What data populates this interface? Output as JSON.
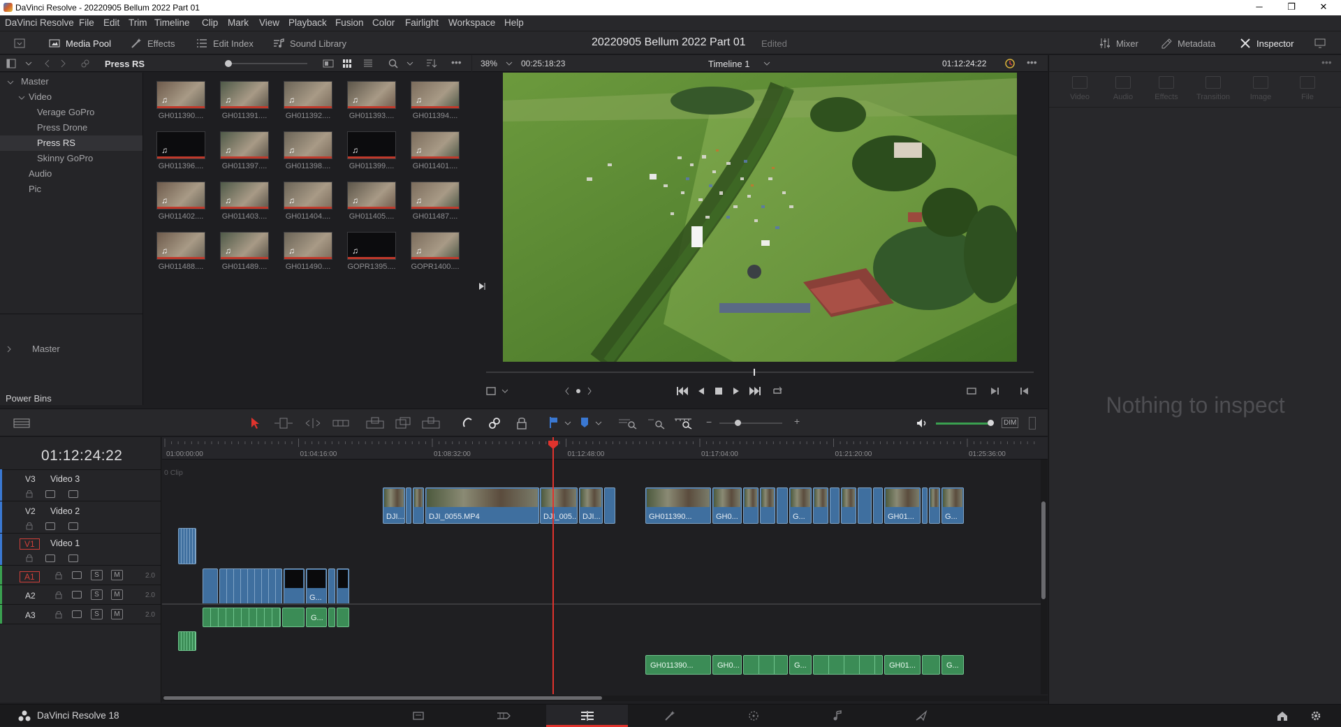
{
  "window": {
    "title": "DaVinci Resolve - 20220905 Bellum 2022 Part 01",
    "minimize": "─",
    "maximize": "❐",
    "close": "✕"
  },
  "menu": [
    "DaVinci Resolve",
    "File",
    "Edit",
    "Trim",
    "Timeline",
    "Clip",
    "Mark",
    "View",
    "Playback",
    "Fusion",
    "Color",
    "Fairlight",
    "Workspace",
    "Help"
  ],
  "toolbar": {
    "media_pool": "Media Pool",
    "effects": "Effects",
    "edit_index": "Edit Index",
    "sound_library": "Sound Library",
    "project_title": "20220905 Bellum 2022 Part 01",
    "project_status": "Edited",
    "mixer": "Mixer",
    "metadata": "Metadata",
    "inspector": "Inspector"
  },
  "media_pool": {
    "current_bin": "Press RS",
    "bins": [
      {
        "label": "Master",
        "level": 0,
        "expanded": true
      },
      {
        "label": "Video",
        "level": 1,
        "expanded": true
      },
      {
        "label": "Verage GoPro",
        "level": 2
      },
      {
        "label": "Press Drone",
        "level": 2
      },
      {
        "label": "Press RS",
        "level": 2,
        "selected": true
      },
      {
        "label": "Skinny GoPro",
        "level": 2
      },
      {
        "label": "Audio",
        "level": 1
      },
      {
        "label": "Pic",
        "level": 1
      }
    ],
    "power_bins_title": "Power Bins",
    "power_bins": [
      {
        "label": "Master"
      }
    ],
    "clips": [
      {
        "name": "GH011390....",
        "dark": false
      },
      {
        "name": "GH011391....",
        "dark": false
      },
      {
        "name": "GH011392....",
        "dark": false
      },
      {
        "name": "GH011393....",
        "dark": false
      },
      {
        "name": "GH011394....",
        "dark": false
      },
      {
        "name": "GH011396....",
        "dark": true
      },
      {
        "name": "GH011397....",
        "dark": false
      },
      {
        "name": "GH011398....",
        "dark": false
      },
      {
        "name": "GH011399....",
        "dark": true
      },
      {
        "name": "GH011401....",
        "dark": false
      },
      {
        "name": "GH011402....",
        "dark": false
      },
      {
        "name": "GH011403....",
        "dark": false
      },
      {
        "name": "GH011404....",
        "dark": false
      },
      {
        "name": "GH011405....",
        "dark": false
      },
      {
        "name": "GH011487....",
        "dark": false
      },
      {
        "name": "GH011488....",
        "dark": false
      },
      {
        "name": "GH011489....",
        "dark": false
      },
      {
        "name": "GH011490....",
        "dark": false
      },
      {
        "name": "GOPR1395....",
        "dark": true
      },
      {
        "name": "GOPR1400....",
        "dark": false
      }
    ]
  },
  "viewer": {
    "zoom": "38%",
    "duration": "00:25:18:23",
    "timeline_name": "Timeline 1",
    "timecode": "01:12:24:22"
  },
  "inspector": {
    "tabs": [
      "Video",
      "Audio",
      "Effects",
      "Transition",
      "Image",
      "File"
    ],
    "empty_message": "Nothing to inspect"
  },
  "timeline": {
    "timecode": "01:12:24:22",
    "ruler": [
      "01:00:00:00",
      "01:04:16:00",
      "01:08:32:00",
      "01:12:48:00",
      "01:17:04:00",
      "01:21:20:00",
      "01:25:36:00"
    ],
    "empty_track_label": "0 Clip",
    "tracks": [
      {
        "id": "V3",
        "name": "Video 3",
        "kind": "video"
      },
      {
        "id": "V2",
        "name": "Video 2",
        "kind": "video"
      },
      {
        "id": "V1",
        "name": "Video 1",
        "kind": "video"
      },
      {
        "id": "A1",
        "name": "",
        "kind": "audio",
        "level": "2.0"
      },
      {
        "id": "A2",
        "name": "",
        "kind": "audio",
        "level": "2.0"
      },
      {
        "id": "A3",
        "name": "",
        "kind": "audio",
        "level": "2.0"
      }
    ],
    "solo_label": "S",
    "mute_label": "M",
    "dim_label": "DIM",
    "clip_labels": {
      "v3_a": "DJI...",
      "v3_main": "DJI_0055.MP4",
      "v3_b": "DJI_005...",
      "v3_c": "DJI...",
      "v3_d": "GH011390...",
      "v3_e": "GH0...",
      "v3_f": "G...",
      "v3_g": "GH01...",
      "v3_h": "G...",
      "v1_a": "G...",
      "a1_a": "G...",
      "a3_a": "GH011390...",
      "a3_b": "GH0...",
      "a3_c": "G...",
      "a3_d": "GH01...",
      "a3_e": "G..."
    }
  },
  "pagebar": {
    "app_name": "DaVinci Resolve 18",
    "pages": [
      "Media",
      "Cut",
      "Edit",
      "Fusion",
      "Color",
      "Fairlight",
      "Deliver"
    ],
    "active_page": "Edit"
  },
  "colors": {
    "video_clip": "#3f6f9f",
    "audio_clip": "#3b8c56",
    "playhead": "#e0332d",
    "active_page_underline": "#e0332d"
  }
}
